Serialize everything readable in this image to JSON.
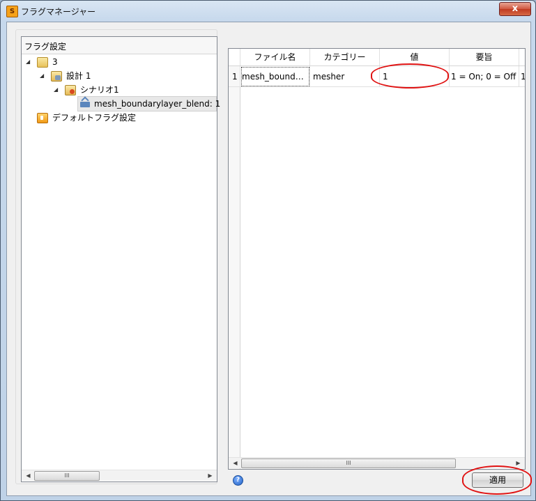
{
  "window": {
    "title": "フラグマネージャー",
    "close_label": "x"
  },
  "tree": {
    "header": "フラグ設定",
    "nodes": [
      {
        "label": "3"
      },
      {
        "label": "設計 1"
      },
      {
        "label": "シナリオ1"
      },
      {
        "label": "mesh_boundarylayer_blend: 1"
      },
      {
        "label": "デフォルトフラグ設定"
      }
    ]
  },
  "grid": {
    "columns": [
      "ファイル名",
      "カテゴリー",
      "値",
      "要旨"
    ],
    "rows": [
      {
        "index": "1",
        "file": "mesh_bound…",
        "category": "mesher",
        "value": "1",
        "summary": "1 = On; 0 = Off",
        "extra": "1"
      }
    ]
  },
  "scroll_glyph": "III",
  "buttons": {
    "apply": "適用",
    "help": "?"
  },
  "colors": {
    "highlight_circle": "#e01212",
    "window_frame": "#bfd2e7"
  }
}
